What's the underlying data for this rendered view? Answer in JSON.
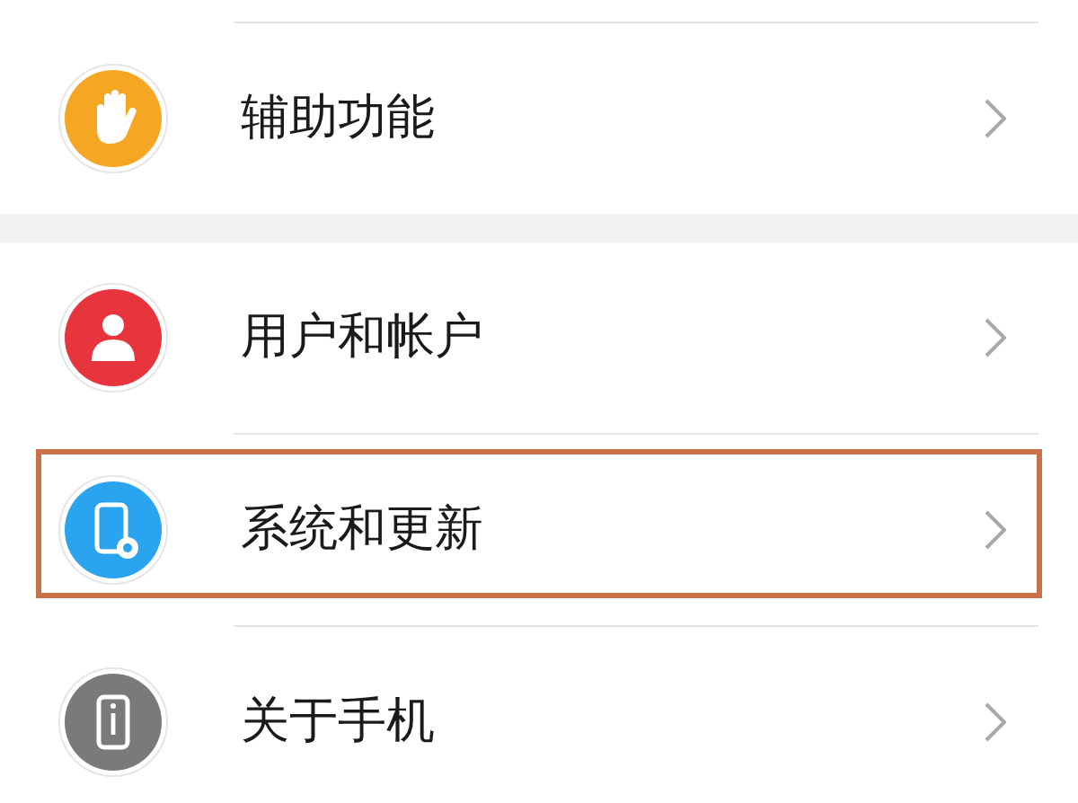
{
  "groups": [
    {
      "items": [
        {
          "label": "辅助功能",
          "kind": "hand",
          "color": "#f5a623",
          "highlighted": false
        }
      ]
    },
    {
      "items": [
        {
          "label": "用户和帐户",
          "kind": "person",
          "color": "#e8343c",
          "highlighted": false
        },
        {
          "label": "系统和更新",
          "kind": "phone-gear",
          "color": "#2aa4ef",
          "highlighted": true
        },
        {
          "label": "关于手机",
          "kind": "phone-info",
          "color": "#7a7a7a",
          "highlighted": false
        }
      ]
    }
  ]
}
